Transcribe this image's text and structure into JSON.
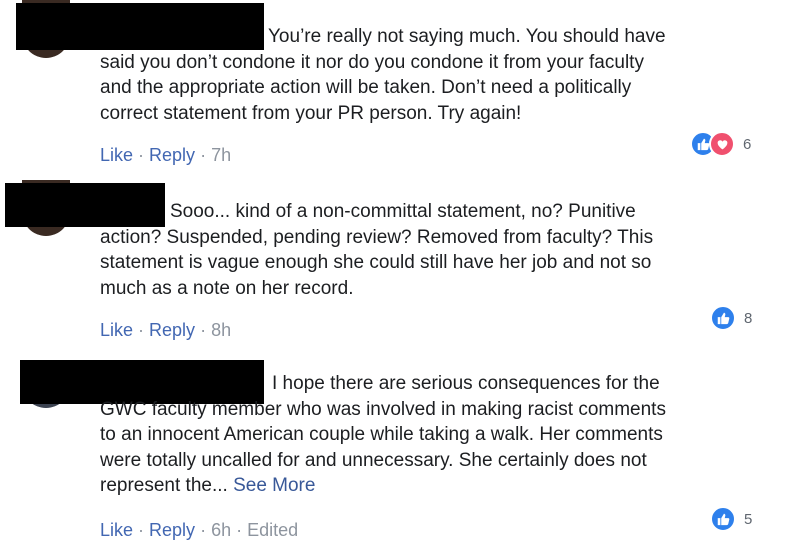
{
  "comments": [
    {
      "lines": [
        "You’re really not saying much. You should have",
        "said you don’t condone it nor do you condone it from your faculty",
        "and the appropriate action will be taken. Don’t need a politically",
        "correct statement from your PR person. Try again!"
      ],
      "actions": {
        "like": "Like",
        "reply": "Reply",
        "time": "7h"
      },
      "reactions": {
        "icons": [
          "like-icon",
          "love-icon"
        ],
        "count": "6"
      }
    },
    {
      "lines": [
        "Sooo... kind of a non-committal statement, no? Punitive",
        "action? Suspended, pending review? Removed from faculty? This",
        "statement is vague enough she could still have her job and not so",
        "much as a note on her record."
      ],
      "actions": {
        "like": "Like",
        "reply": "Reply",
        "time": "8h"
      },
      "reactions": {
        "icons": [
          "like-icon"
        ],
        "count": "8"
      }
    },
    {
      "lines": [
        "I hope there are serious consequences for the",
        "GWC faculty member who was involved in making racist comments",
        "to an innocent American couple while taking a walk. Her comments",
        "were totally uncalled for and unnecessary. She certainly does not",
        "represent the..."
      ],
      "see_more": "See More",
      "actions": {
        "like": "Like",
        "reply": "Reply",
        "time": "6h",
        "edited": "Edited"
      },
      "reactions": {
        "icons": [
          "like-icon"
        ],
        "count": "5"
      }
    }
  ],
  "colors": {
    "link": "#4267b2",
    "like_blue": "#2e80ec",
    "love_red": "#f0506e",
    "meta_gray": "#8d949e"
  }
}
